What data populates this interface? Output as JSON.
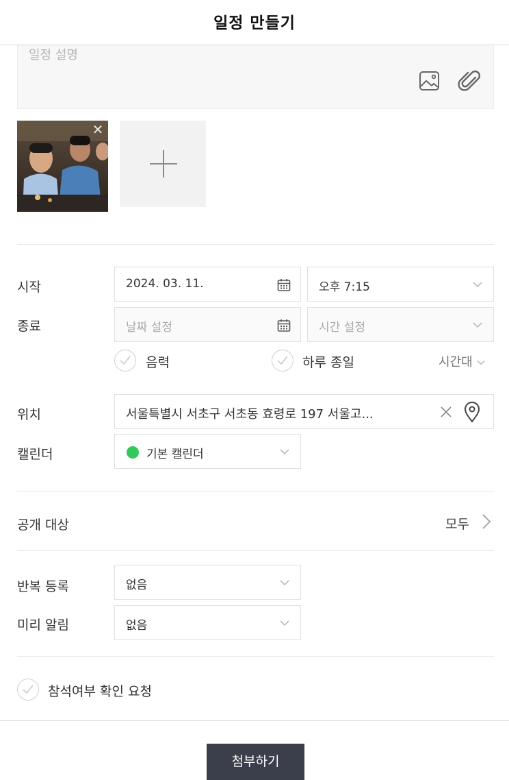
{
  "header": {
    "title": "일정 만들기"
  },
  "description": {
    "placeholder": "일정 설명"
  },
  "attachments": {
    "thumbnail_close": "✕"
  },
  "schedule": {
    "start_label": "시작",
    "start_date": "2024. 03. 11.",
    "start_time": "오후 7:15",
    "end_label": "종료",
    "end_date_placeholder": "날짜 설정",
    "end_time_placeholder": "시간 설정",
    "lunar_label": "음력",
    "all_day_label": "하루 종일",
    "timezone_label": "시간대"
  },
  "location": {
    "label": "위치",
    "value": "서울특별시 서초구 서초동 효령로 197 서울고..."
  },
  "calendar": {
    "label": "캘린더",
    "value": "기본 캘린더",
    "color": "#34c759"
  },
  "visibility": {
    "label": "공개 대상",
    "value": "모두"
  },
  "repeat": {
    "label": "반복 등록",
    "value": "없음"
  },
  "reminder": {
    "label": "미리 알림",
    "value": "없음"
  },
  "rsvp": {
    "label": "참석여부 확인 요청"
  },
  "footer": {
    "attach_button": "첨부하기"
  }
}
